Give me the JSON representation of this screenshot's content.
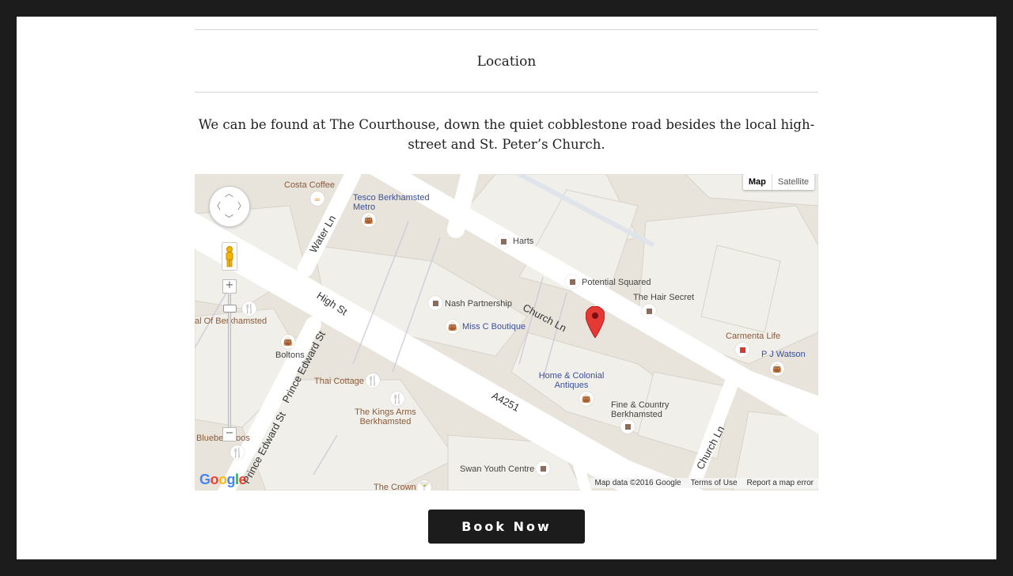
{
  "section": {
    "title": "Location",
    "description": "We can be found at The Courthouse, down the quiet cobblestone road besides the local high-street and St. Peter’s Church."
  },
  "map": {
    "type_buttons": [
      "Map",
      "Satellite"
    ],
    "active_type": "Map",
    "zoom_in": "+",
    "zoom_out": "−",
    "logo": "Google",
    "attribution": {
      "map_data": "Map data ©2016 Google",
      "terms": "Terms of Use",
      "report": "Report a map error"
    },
    "roads": [
      "Water Ln",
      "High St",
      "Church Ln",
      "A4251",
      "Prince Edward St",
      "Prince Edward St",
      "Church Ln"
    ],
    "places": {
      "costa": "Costa Coffee",
      "tesco": "Tesco Berkhamsted Metro",
      "harts": "Harts",
      "potential_squared": "Potential Squared",
      "hair_secret": "The Hair Secret",
      "nash": "Nash Partnership",
      "miss_c": "Miss C Boutique",
      "carmenta": "Carmenta Life",
      "pj_watson": "P J Watson",
      "home_colonial": "Home & Colonial Antiques",
      "fine_country": "Fine & Country Berkhamsted",
      "bolt": "al Of Berkhamsted",
      "boltons": "Boltons",
      "thai": "Thai Cottage",
      "kings_arms": "The Kings Arms Berkhamsted",
      "bluebell": "Bluebell Roos",
      "swan": "Swan Youth Centre",
      "crown": "The Crown"
    },
    "icons": {
      "pan": "pan-control-icon",
      "pegman": "street-view-pegman-icon",
      "marker": "map-marker-icon",
      "shop": "shopping-bag-icon",
      "food": "fork-knife-icon",
      "cafe": "coffee-cup-icon",
      "place": "place-square-icon"
    }
  },
  "cta": {
    "label": "Book Now"
  },
  "colors": {
    "page_bg": "#1c1c1c",
    "card_bg": "#ffffff",
    "button_bg": "#1c1c1c",
    "marker": "#e53935"
  }
}
